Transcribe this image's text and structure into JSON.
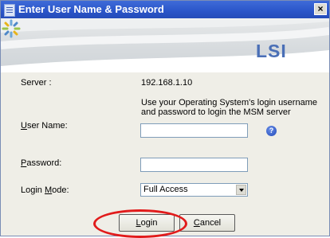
{
  "window": {
    "title": "Enter User Name & Password",
    "close_label": "×"
  },
  "banner": {
    "logo_text": "LSI"
  },
  "form": {
    "server_label": "Server :",
    "server_value": "192.168.1.10",
    "note": "Use your Operating System's login username and password to login the MSM server",
    "username_label_first": "U",
    "username_label_rest": "ser Name:",
    "username_value": "",
    "help_label": "?",
    "password_label_first": "P",
    "password_label_rest": "assword:",
    "password_value": "",
    "mode_label_prefix": "Login ",
    "mode_label_first": "M",
    "mode_label_rest": "ode:",
    "mode_value": "Full Access"
  },
  "buttons": {
    "login_first": "L",
    "login_rest": "ogin",
    "cancel_first": "C",
    "cancel_rest": "ancel"
  },
  "colors": {
    "titlebar": "#2a55c9",
    "highlight": "#e11b1b",
    "logo": "#4a6fb6"
  }
}
